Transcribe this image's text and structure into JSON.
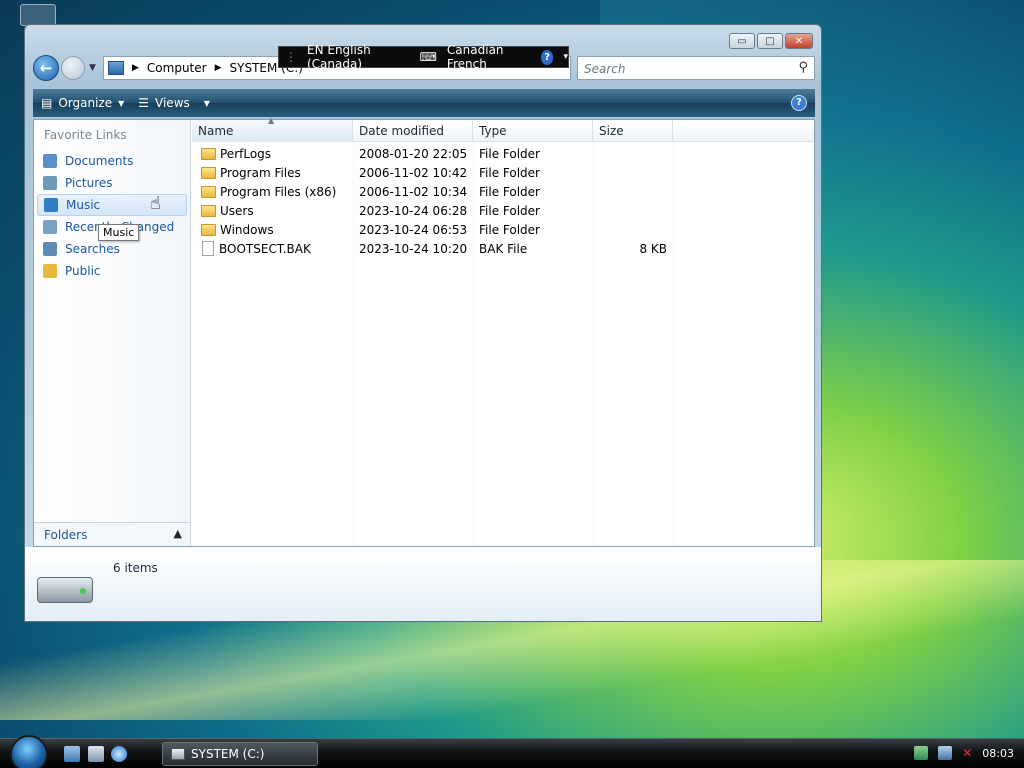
{
  "window": {
    "address": {
      "root": "Computer",
      "current": "SYSTEM (C:)"
    },
    "search_placeholder": "Search",
    "caption_buttons": {
      "minimize": "▭",
      "maximize": "□",
      "close": "✕"
    }
  },
  "language_bar": {
    "language": "EN English (Canada)",
    "keyboard": "Canadian French",
    "help": "?"
  },
  "toolbar": {
    "organize": "Organize",
    "views": "Views",
    "help": "?"
  },
  "nav_pane": {
    "title": "Favorite Links",
    "items": [
      {
        "label": "Documents",
        "icon": "documents-icon",
        "color": "#5a8fc8"
      },
      {
        "label": "Pictures",
        "icon": "pictures-icon",
        "color": "#6b9bb8"
      },
      {
        "label": "Music",
        "icon": "music-icon",
        "color": "#2f7fc4"
      },
      {
        "label": "Recently Changed",
        "icon": "recently-changed-icon",
        "color": "#7aa0c4"
      },
      {
        "label": "Searches",
        "icon": "searches-icon",
        "color": "#5d8db5"
      },
      {
        "label": "Public",
        "icon": "public-folder-icon",
        "color": "#e9b83e"
      }
    ],
    "folders_label": "Folders",
    "tooltip": "Music"
  },
  "file_list": {
    "columns": [
      "Name",
      "Date modified",
      "Type",
      "Size"
    ],
    "rows": [
      {
        "name": "PerfLogs",
        "date": "2008-01-20 22:05",
        "type": "File Folder",
        "size": "",
        "kind": "folder"
      },
      {
        "name": "Program Files",
        "date": "2006-11-02 10:42",
        "type": "File Folder",
        "size": "",
        "kind": "folder"
      },
      {
        "name": "Program Files (x86)",
        "date": "2006-11-02 10:34",
        "type": "File Folder",
        "size": "",
        "kind": "folder"
      },
      {
        "name": "Users",
        "date": "2023-10-24 06:28",
        "type": "File Folder",
        "size": "",
        "kind": "folder"
      },
      {
        "name": "Windows",
        "date": "2023-10-24 06:53",
        "type": "File Folder",
        "size": "",
        "kind": "folder"
      },
      {
        "name": "BOOTSECT.BAK",
        "date": "2023-10-24 10:20",
        "type": "BAK File",
        "size": "8 KB",
        "kind": "file"
      }
    ]
  },
  "details": {
    "items_count": "6 items"
  },
  "taskbar": {
    "active_window": "SYSTEM (C:)",
    "clock": "08:03"
  }
}
